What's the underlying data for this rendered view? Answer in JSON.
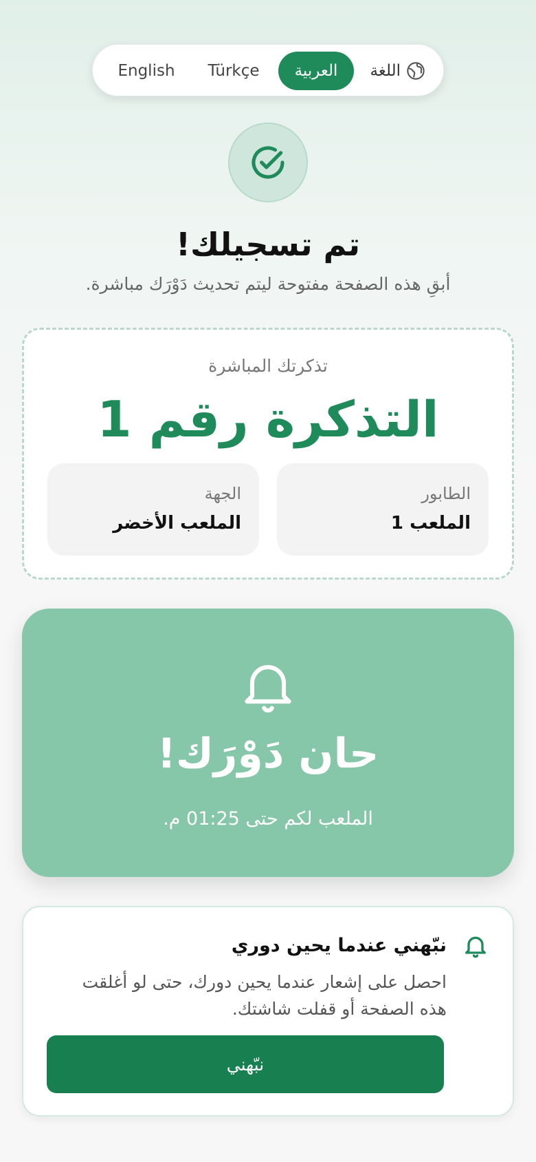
{
  "language_selector": {
    "label": "اللغة",
    "icon": "globe-icon",
    "options": [
      {
        "label": "العربية",
        "selected": true
      },
      {
        "label": "Türkçe",
        "selected": false
      },
      {
        "label": "English",
        "selected": false
      }
    ]
  },
  "header": {
    "icon": "check-circle-icon",
    "title": "تم تسجيلك!",
    "subtitle": "أبقِ هذه الصفحة مفتوحة ليتم تحديث دَوْرَك مباشرة."
  },
  "ticket": {
    "label": "تذكرتك المباشرة",
    "number": "التذكرة رقم 1",
    "queue_label": "الطابور",
    "queue_value": "الملعب 1",
    "destination_label": "الجهة",
    "destination_value": "الملعب الأخضر"
  },
  "turn_alert": {
    "icon": "bell-icon",
    "title": "حان دَوْرَك!",
    "subtitle": "الملعب لكم حتى 01:25 م."
  },
  "notify": {
    "icon": "bell-icon",
    "title": "نبّهني عندما يحين دوري",
    "description": "احصل على إشعار عندما يحين دورك، حتى لو أغلقت هذه الصفحة أو قفلت شاشتك.",
    "button_label": "نبّهني"
  },
  "colors": {
    "accent": "#1f8b5a",
    "turn_card": "#86c6a9",
    "button": "#177f50"
  }
}
